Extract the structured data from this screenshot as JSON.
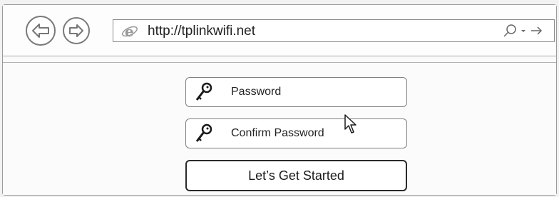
{
  "browser": {
    "url": "http://tplinkwifi.net"
  },
  "form": {
    "password_label": "Password",
    "confirm_label": "Confirm Password",
    "start_button_label": "Let’s Get Started"
  },
  "icons": {
    "back": "back-arrow-icon",
    "forward": "forward-arrow-icon",
    "browser": "ie-icon",
    "search": "search-icon",
    "go": "go-arrow-icon",
    "key": "key-icon",
    "cursor": "mouse-pointer-icon"
  }
}
